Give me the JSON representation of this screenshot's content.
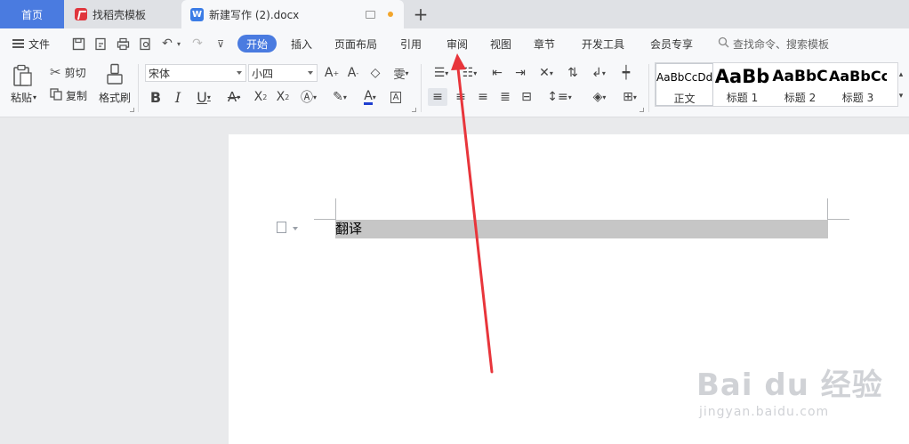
{
  "tabs": {
    "home": "首页",
    "template": "找稻壳模板",
    "document": "新建写作 (2).docx",
    "new_tab": "+"
  },
  "menu": {
    "file": "文件",
    "items": [
      "开始",
      "插入",
      "页面布局",
      "引用",
      "审阅",
      "视图",
      "章节",
      "开发工具",
      "会员专享"
    ],
    "active": "开始",
    "search_placeholder": "查找命令、搜索模板"
  },
  "ribbon": {
    "paste": "粘贴",
    "cut": "剪切",
    "copy": "复制",
    "format_painter": "格式刷",
    "font_name": "宋体",
    "font_size": "小四",
    "styles": [
      {
        "sample": "AaBbCcDd",
        "name": "正文"
      },
      {
        "sample": "AaBb",
        "name": "标题 1"
      },
      {
        "sample": "AaBbC",
        "name": "标题 2"
      },
      {
        "sample": "AaBbCc",
        "name": "标题 3"
      }
    ]
  },
  "document": {
    "text": "翻译"
  },
  "watermark": {
    "main": "Bai du 经验",
    "sub": "jingyan.baidu.com"
  },
  "colors": {
    "accent": "#4a7be0",
    "arrow": "#e8353b",
    "selection": "#c6c6c6"
  }
}
